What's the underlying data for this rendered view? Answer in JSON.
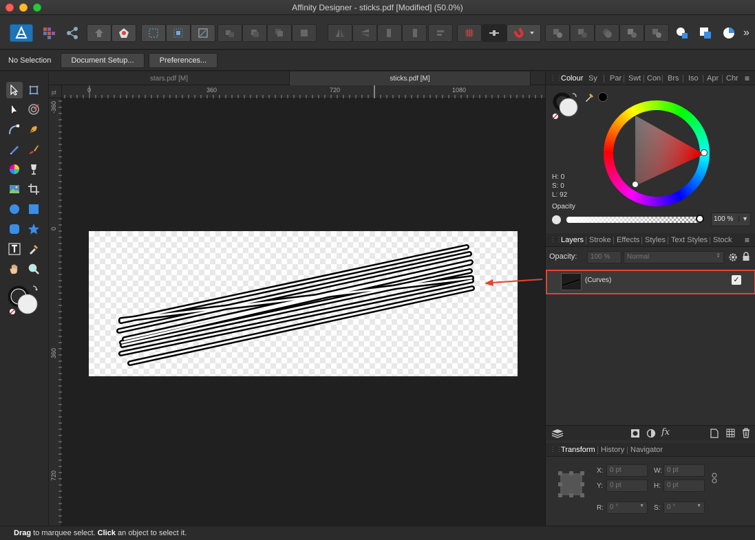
{
  "window": {
    "title": "Affinity Designer - sticks.pdf [Modified] (50.0%)"
  },
  "toolbar": {
    "overflow_label": "»"
  },
  "context": {
    "selection_label": "No Selection",
    "document_setup_label": "Document Setup...",
    "preferences_label": "Preferences..."
  },
  "tabs": [
    {
      "label": "stars.pdf [M]"
    },
    {
      "label": "sticks.pdf [M]"
    }
  ],
  "ruler": {
    "unit": "pt",
    "h_ticks": [
      "0",
      "360",
      "720",
      "1080"
    ],
    "v_ticks": [
      "-360",
      "0",
      "360",
      "720"
    ]
  },
  "colour_panel": {
    "tabs": [
      "Colour",
      "Sy",
      "Par",
      "Swt",
      "Con",
      "Brs",
      "Iso",
      "Apr",
      "Chr"
    ],
    "h": "H: 0",
    "s": "S: 0",
    "l": "L: 92",
    "opacity_label": "Opacity",
    "opacity_value": "100 %",
    "accent_color": "#d42020"
  },
  "layers_panel": {
    "tabs": [
      "Layers",
      "Stroke",
      "Effects",
      "Styles",
      "Text Styles",
      "Stock"
    ],
    "opacity_label": "Opacity:",
    "opacity_value": "100 %",
    "blend_mode": "Normal",
    "layer": {
      "name": "(Curves)",
      "visible_check": "✓"
    },
    "fx_label": "fx"
  },
  "transform_panel": {
    "tabs": [
      "Transform",
      "History",
      "Navigator"
    ],
    "x_label": "X:",
    "x_value": "0 pt",
    "y_label": "Y:",
    "y_value": "0 pt",
    "w_label": "W:",
    "w_value": "0 pt",
    "h_label": "H:",
    "h_value": "0 pt",
    "r_label": "R:",
    "r_value": "0 °",
    "s_label": "S:",
    "s_value": "0 °"
  },
  "status": {
    "drag": "Drag",
    "text1": " to marquee select. ",
    "click": "Click",
    "text2": " an object to select it."
  }
}
